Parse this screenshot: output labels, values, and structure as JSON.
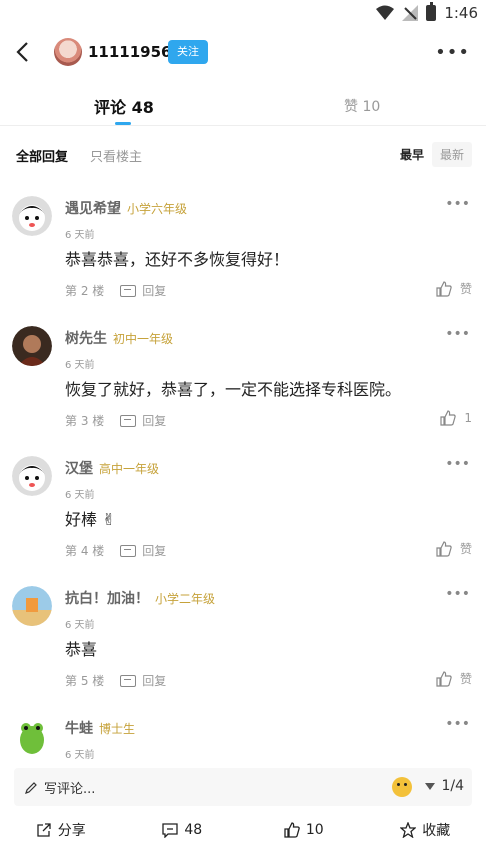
{
  "status": {
    "time": "1:46"
  },
  "header": {
    "username": "11111956",
    "follow_label": "关注"
  },
  "tabs": {
    "comments": "评论 48",
    "likes": "赞 10"
  },
  "filters": {
    "all": "全部回复",
    "owner_only": "只看楼主",
    "sort_earliest": "最早",
    "sort_latest": "最新"
  },
  "comments": [
    {
      "name": "遇见希望",
      "grade": "小学六年级",
      "time": "6 天前",
      "text": "恭喜恭喜，还好不多恢复得好！",
      "floor": "第 2 楼",
      "reply": "回复",
      "like": "赞"
    },
    {
      "name": "树先生",
      "grade": "初中一年级",
      "time": "6 天前",
      "text": "恢复了就好，恭喜了，一定不能选择专科医院。",
      "floor": "第 3 楼",
      "reply": "回复",
      "like": "1"
    },
    {
      "name": "汉堡",
      "grade": "高中一年级",
      "time": "6 天前",
      "text": "好棒 ✌",
      "floor": "第 4 楼",
      "reply": "回复",
      "like": "赞"
    },
    {
      "name": "抗白！加油！",
      "grade": "小学二年级",
      "time": "6 天前",
      "text": "恭喜",
      "floor": "第 5 楼",
      "reply": "回复",
      "like": "赞"
    },
    {
      "name": "牛蛙",
      "grade": "博士生",
      "time": "6 天前",
      "text": "",
      "floor": "",
      "reply": "",
      "like": ""
    }
  ],
  "composer": {
    "placeholder": "写评论...",
    "page_indicator": "1/4"
  },
  "actions": {
    "share": "分享",
    "comments": "48",
    "likes": "10",
    "favorite": "收藏"
  },
  "colors": {
    "accent": "#2fa7ee",
    "grade": "#c6a23a"
  }
}
